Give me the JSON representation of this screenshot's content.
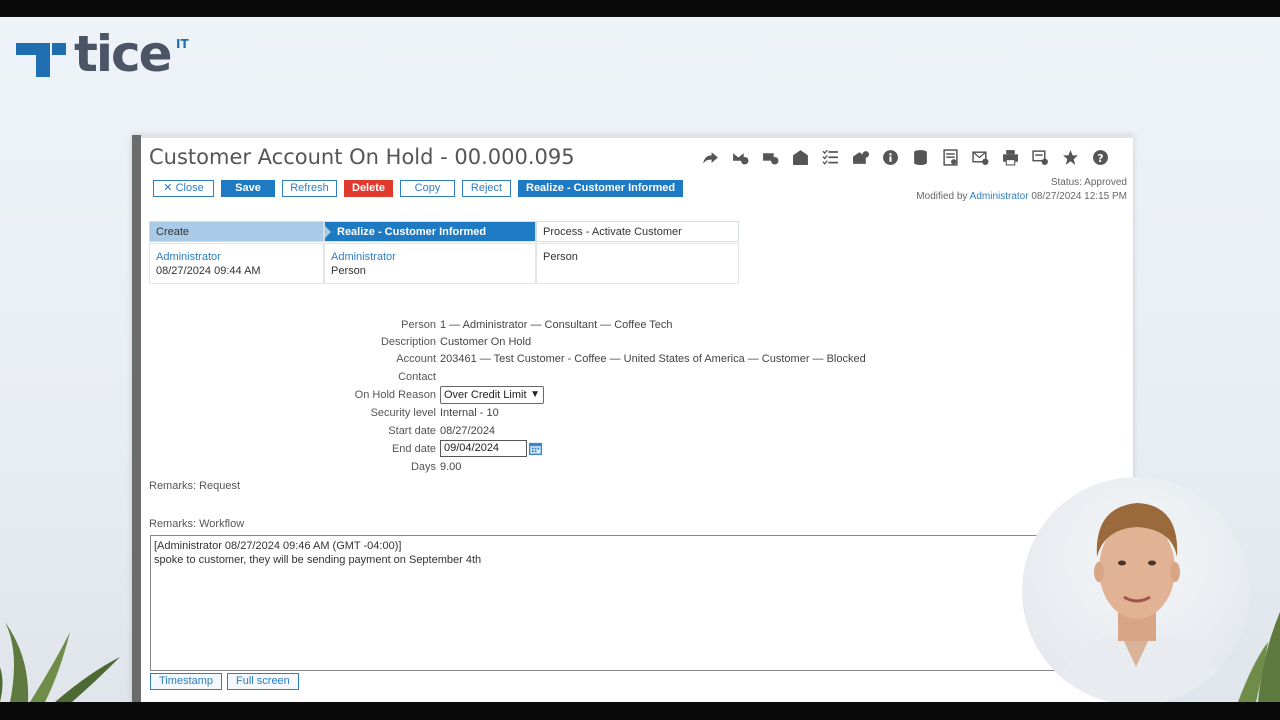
{
  "brand": {
    "logo_text": "tice",
    "logo_sup": "IT"
  },
  "window": {
    "title": "Customer Account On Hold - 00.000.095",
    "toolbar_icons": [
      "share-icon",
      "email-out-icon",
      "email-in-icon",
      "envelope-icon",
      "checklist-icon",
      "email-attach-icon",
      "info-icon",
      "database-icon",
      "report-icon",
      "mail-check-icon",
      "print-icon",
      "print-settings-icon",
      "star-icon",
      "help-icon"
    ]
  },
  "buttons": {
    "close": "Close",
    "save": "Save",
    "refresh": "Refresh",
    "delete": "Delete",
    "copy": "Copy",
    "reject": "Reject",
    "realize": "Realize - Customer Informed"
  },
  "status": {
    "status_text": "Status: Approved",
    "modified_prefix": "Modified by",
    "modified_user": "Administrator",
    "modified_date": "08/27/2024 12:15 PM"
  },
  "steps": [
    {
      "label": "Create",
      "user": "Administrator",
      "detail": "08/27/2024 09:44 AM"
    },
    {
      "label": "Realize - Customer Informed",
      "user": "Administrator",
      "detail": "Person"
    },
    {
      "label": "Process - Activate Customer",
      "user": "",
      "detail": "Person"
    }
  ],
  "form": {
    "person_label": "Person",
    "person_value": "1 — Administrator — Consultant — Coffee Tech",
    "description_label": "Description",
    "description_value": "Customer On Hold",
    "account_label": "Account",
    "account_value": "203461 — Test Customer - Coffee — United States of America — Customer — Blocked",
    "contact_label": "Contact",
    "onhold_label": "On Hold Reason",
    "onhold_value": "Over Credit Limit",
    "security_label": "Security level",
    "security_value": "Internal - 10",
    "start_label": "Start date",
    "start_value": "08/27/2024",
    "end_label": "End date",
    "end_value": "09/04/2024",
    "days_label": "Days",
    "days_value": "9.00"
  },
  "remarks": {
    "request_label": "Remarks: Request",
    "workflow_label": "Remarks: Workflow",
    "line1": "[Administrator 08/27/2024 09:46 AM (GMT -04:00)]",
    "line2": "spoke to customer, they will be sending payment on September 4th"
  },
  "bottom_buttons": {
    "timestamp": "Timestamp",
    "fullscreen": "Full screen"
  }
}
